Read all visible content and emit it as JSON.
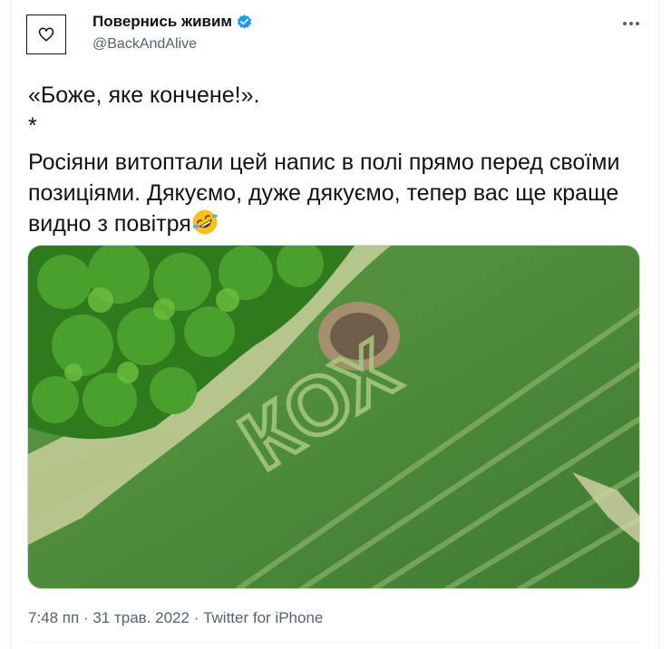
{
  "author": {
    "name": "Повернись живим",
    "handle": "@BackAndAlive",
    "verified": true
  },
  "tweet": {
    "line1": "«Боже, яке кончене!».",
    "line2": "*",
    "line3": "Росіяни витоптали цей напис в полі прямо перед своїми позиціями. Дякуємо, дуже дякуємо, тепер вас ще краще видно з повітря",
    "emoji": "rolling-on-the-floor-laughing-emoji"
  },
  "media": {
    "field_text": "КОХ"
  },
  "meta": {
    "time": "7:48 пп",
    "separator": " · ",
    "date": "31 трав. 2022",
    "source": "Twitter for iPhone"
  },
  "colors": {
    "verified_blue": "#1d9bf0",
    "secondary_text": "#536471",
    "field_green": "#4f8a3a",
    "tree_green": "#3c8a22"
  }
}
